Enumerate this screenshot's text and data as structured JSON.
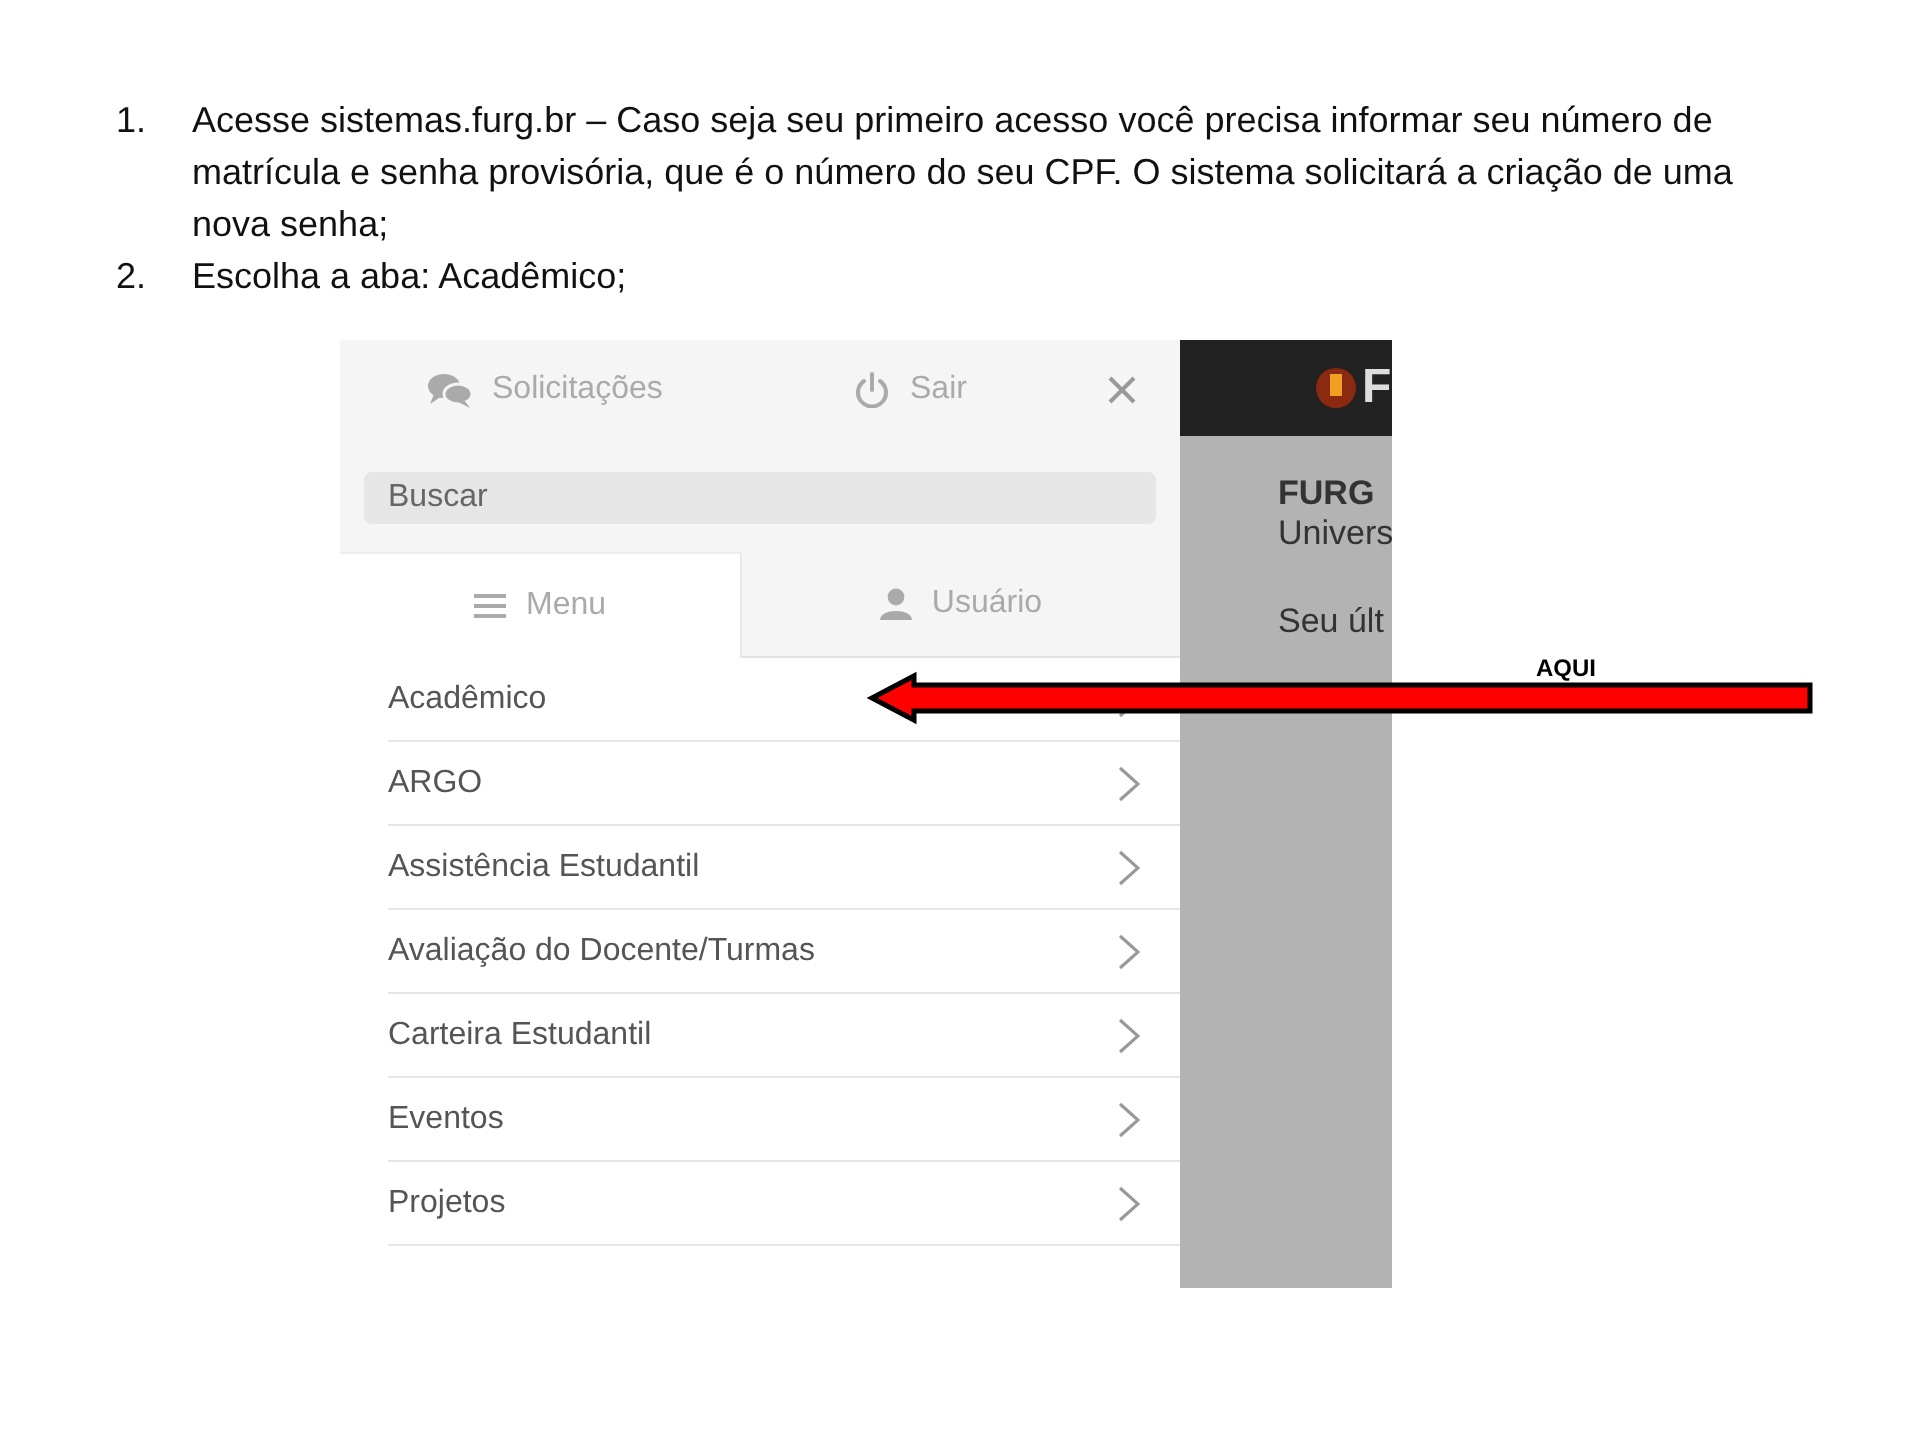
{
  "instructions": [
    {
      "number": "1.",
      "text": "Acesse sistemas.furg.br – Caso seja seu primeiro acesso você precisa informar seu número de matrícula e senha provisória, que é o número do seu CPF. O sistema solicitará a criação de uma nova senha;"
    },
    {
      "number": "2.",
      "text": "Escolha a aba: Acadêmico;"
    }
  ],
  "screenshot": {
    "drawer": {
      "actions": [
        {
          "kind": "chat",
          "label": "Solicitações"
        },
        {
          "kind": "power",
          "label": "Sair"
        }
      ],
      "search": {
        "placeholder": "Buscar"
      },
      "tabs": [
        {
          "kind": "menu",
          "label": "Menu",
          "selected": true
        },
        {
          "kind": "user",
          "label": "Usuário",
          "selected": false
        }
      ],
      "items": [
        "Acadêmico",
        "ARGO",
        "Assistência Estudantil",
        "Avaliação do Docente/Turmas",
        "Carteira Estudantil",
        "Eventos",
        "Projetos"
      ]
    },
    "page": {
      "logo_text": "F",
      "title": "FURG",
      "subtitle": "Univers",
      "text": "Seu últ"
    }
  },
  "callout": {
    "label": "AQUI"
  }
}
